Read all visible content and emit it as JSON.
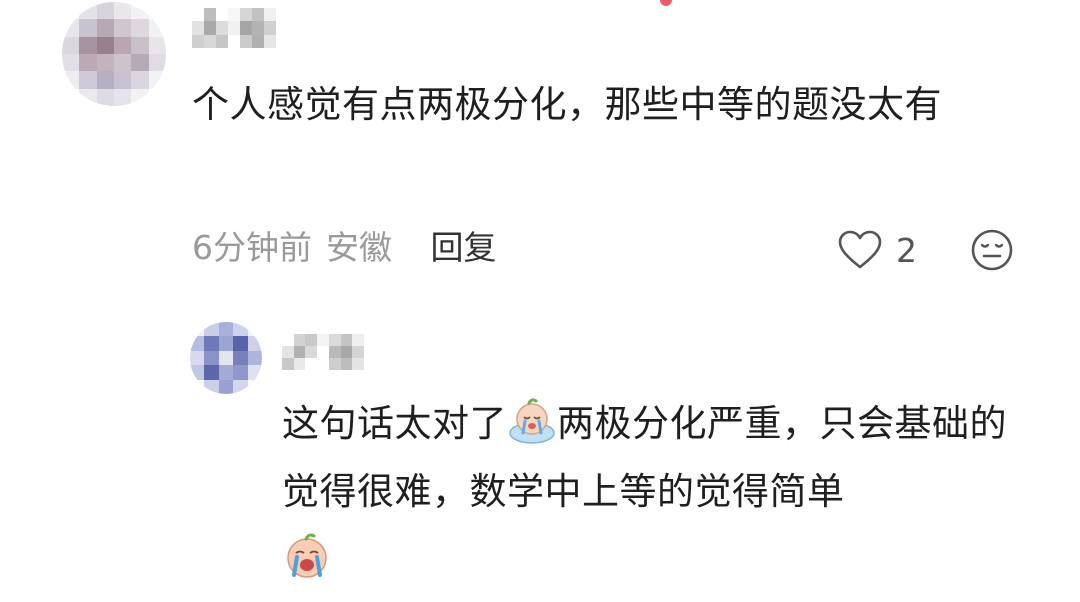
{
  "comment": {
    "avatar_icon": "avatar-pixelated-icon",
    "text": "个人感觉有点两极分化，那些中等的题没太有",
    "time": "6分钟前",
    "location": "安徽",
    "reply_label": "回复",
    "like_icon": "heart-outline-icon",
    "like_count": "2",
    "dislike_icon": "neutral-face-icon"
  },
  "reply": {
    "avatar_icon": "avatar-pixelated-icon",
    "text_part1": "这句话太对了",
    "emoji1": "crying-peach-emoji",
    "text_part2": "两极分化严重，只会基础的觉得很难，数学中上等的觉得简单",
    "emoji2": "crying-peach-emoji"
  },
  "colors": {
    "text": "#1f1f1f",
    "meta": "#9a9a9a",
    "notification_dot": "#f05a6a"
  }
}
